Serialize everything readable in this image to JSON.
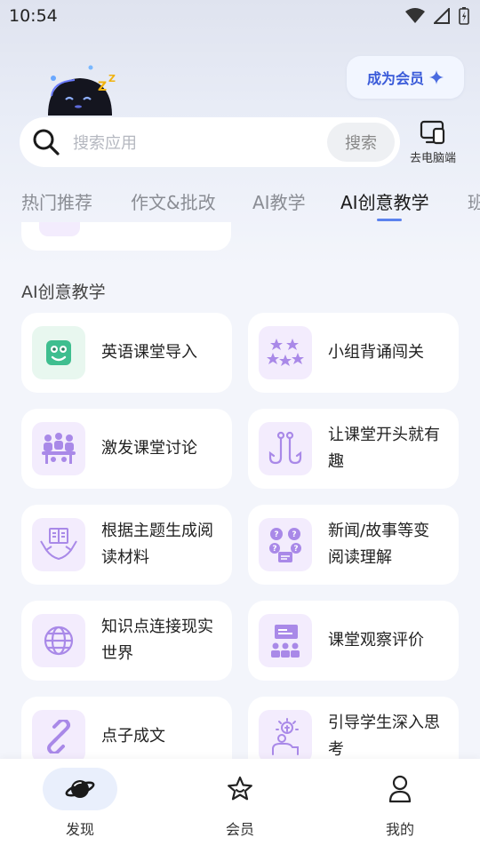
{
  "status_bar": {
    "time": "10:54"
  },
  "header": {
    "member_button": {
      "label": "成为会员",
      "icon": "sparkle-icon"
    },
    "search": {
      "placeholder": "搜索应用",
      "button_label": "搜索"
    },
    "pc_link": {
      "label": "去电脑端",
      "icon": "pc-mobile-icon"
    }
  },
  "tabs": [
    {
      "label": "热门推荐",
      "active": false
    },
    {
      "label": "作文&批改",
      "active": false
    },
    {
      "label": "AI教学",
      "active": false
    },
    {
      "label": "AI创意教学",
      "active": true
    },
    {
      "label": "班",
      "active": false
    }
  ],
  "section": {
    "title": "AI创意教学",
    "cards": [
      {
        "label": "英语课堂导入",
        "icon": "smiley-board-icon"
      },
      {
        "label": "小组背诵闯关",
        "icon": "stars-icon"
      },
      {
        "label": "激发课堂讨论",
        "icon": "group-discussion-icon"
      },
      {
        "label": "让课堂开头就有趣",
        "icon": "fishhooks-icon"
      },
      {
        "label": "根据主题生成阅读材料",
        "icon": "hands-book-icon"
      },
      {
        "label": "新闻/故事等变阅读理解",
        "icon": "question-bubbles-icon"
      },
      {
        "label": "知识点连接现实世界",
        "icon": "globe-icon"
      },
      {
        "label": "课堂观察评价",
        "icon": "classroom-board-icon"
      },
      {
        "label": "点子成文",
        "icon": "chain-link-icon"
      },
      {
        "label": "引导学生深入思考",
        "icon": "thinking-person-icon"
      }
    ]
  },
  "bottom_nav": [
    {
      "label": "发现",
      "icon": "planet-icon",
      "active": true
    },
    {
      "label": "会员",
      "icon": "star-badge-icon",
      "active": false
    },
    {
      "label": "我的",
      "icon": "person-icon",
      "active": false
    }
  ],
  "colors": {
    "accent": "#5b82ee",
    "member_text": "#3a5bd9",
    "icon_purple": "#a989e8",
    "icon_green": "#3fbe8f",
    "icon_bg_purple": "#f3ecfd",
    "icon_bg_green": "#e8f7ef"
  }
}
